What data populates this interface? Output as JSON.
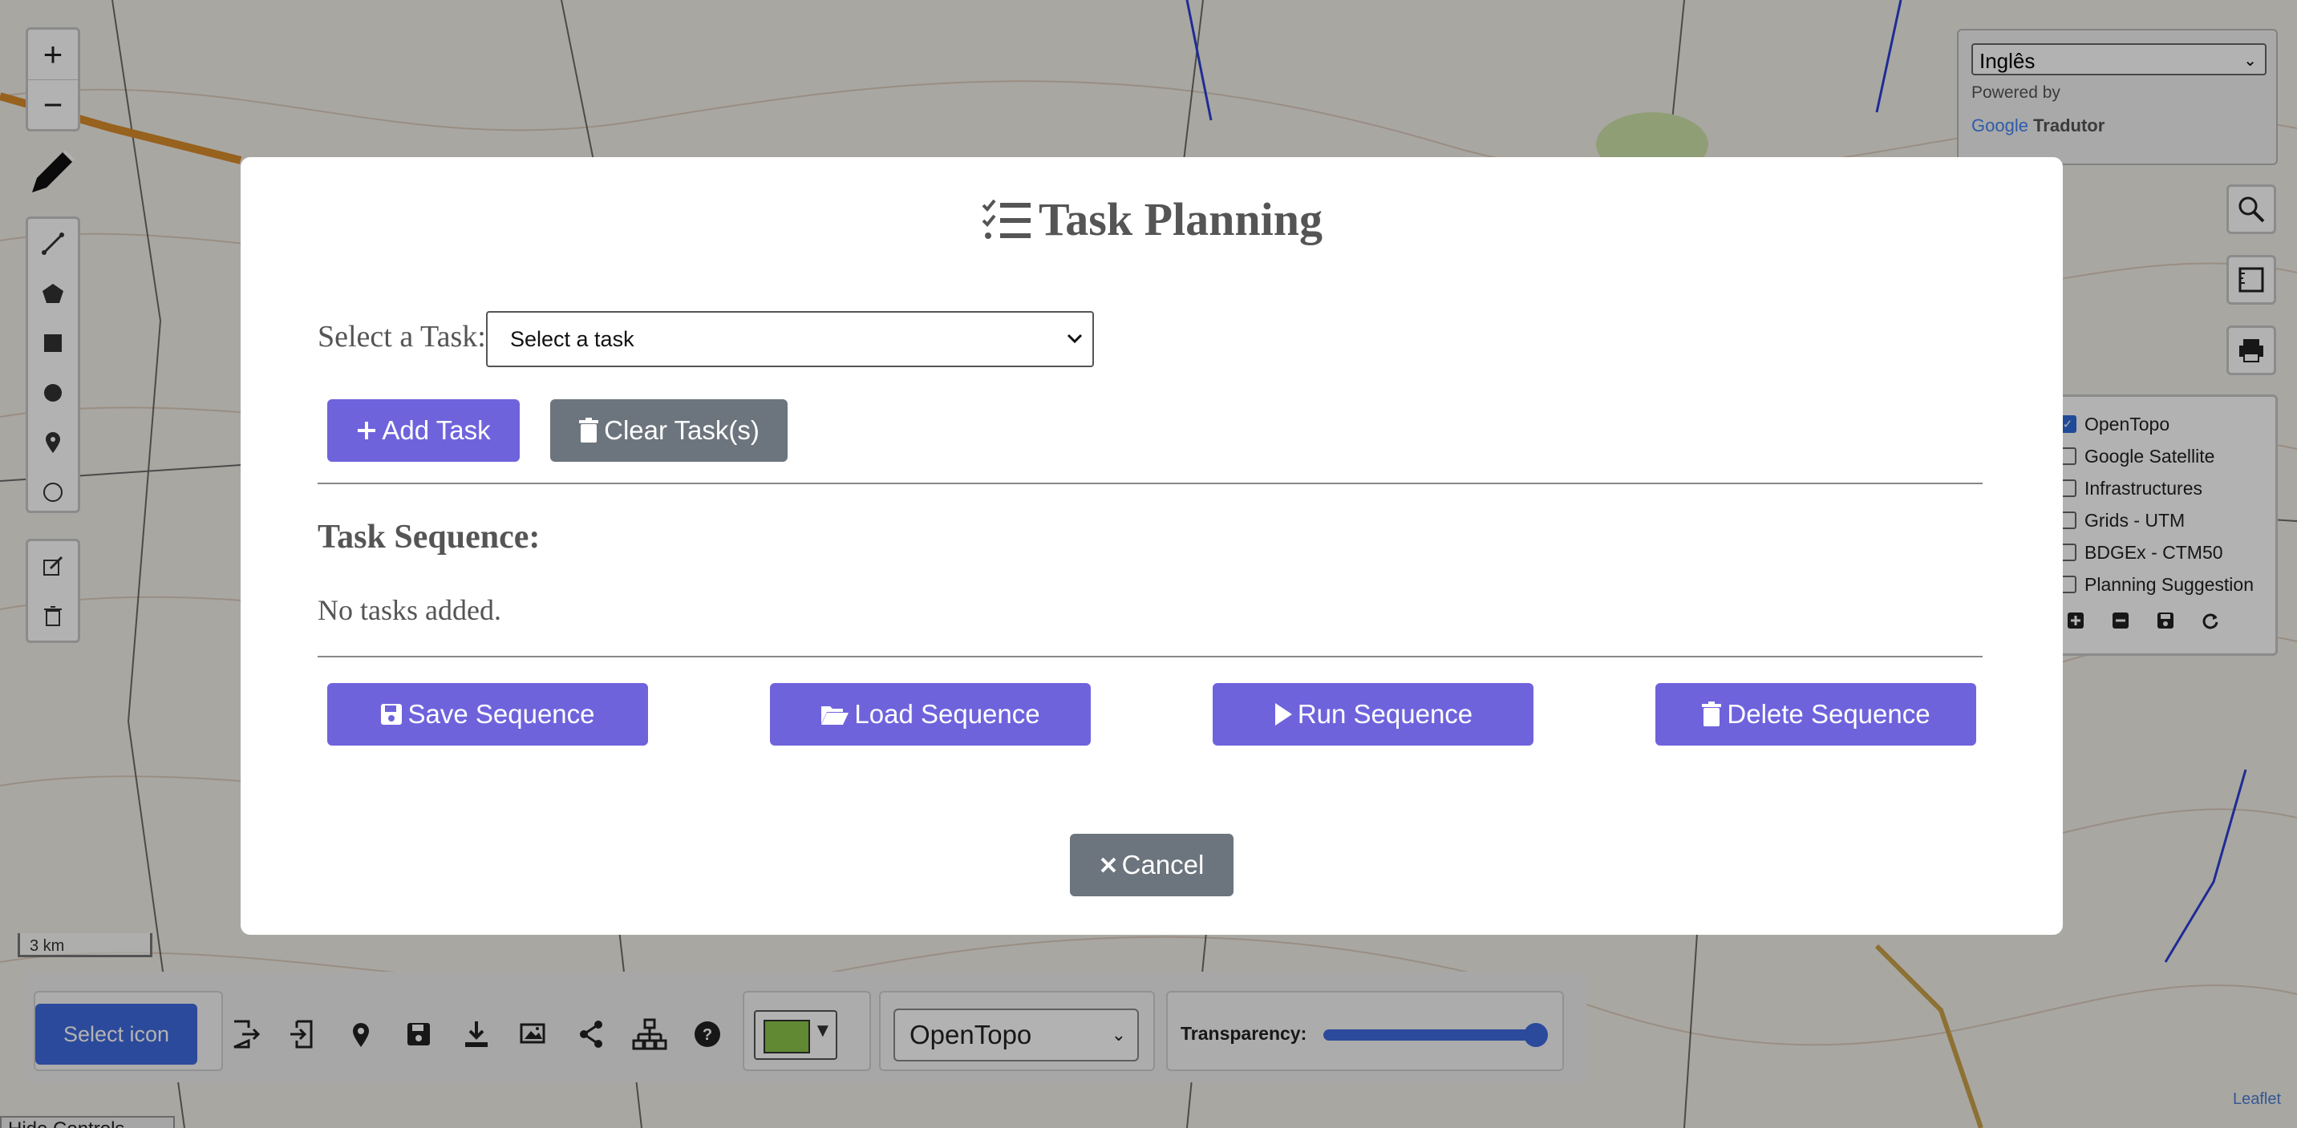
{
  "map": {
    "zoom_in": "+",
    "zoom_out": "−",
    "scale_label": "3 km",
    "attribution": "Leaflet",
    "hide_controls": "Hide Controls"
  },
  "translate": {
    "language": "Inglês",
    "powered_by": "Powered by",
    "google": "Google",
    "product": "Tradutor"
  },
  "layers": [
    {
      "label": "OpenTopo",
      "checked": true
    },
    {
      "label": "Google Satellite",
      "checked": false
    },
    {
      "label": "Infrastructures",
      "checked": false
    },
    {
      "label": "Grids - UTM",
      "checked": false
    },
    {
      "label": "BDGEx - CTM50",
      "checked": false
    },
    {
      "label": "Planning Suggestion",
      "checked": false
    }
  ],
  "bottom_bar": {
    "select_icon": "Select icon",
    "basemap": "OpenTopo",
    "transparency_label": "Transparency:",
    "transparency_value": 0.95,
    "swatch_color": "#8bc34a",
    "swatch_arrow": "▼"
  },
  "modal": {
    "title": "Task Planning",
    "select_label": "Select a Task:",
    "select_value": "Select a task",
    "add_task": "Add Task",
    "clear_tasks": "Clear Task(s)",
    "sequence_heading": "Task Sequence:",
    "empty_text": "No tasks added.",
    "save_sequence": "Save Sequence",
    "load_sequence": "Load Sequence",
    "run_sequence": "Run Sequence",
    "delete_sequence": "Delete Sequence",
    "cancel": "Cancel"
  },
  "colors": {
    "primary": "#6f63dc",
    "secondary": "#6c757d",
    "accent_blue": "#3f6bde"
  }
}
